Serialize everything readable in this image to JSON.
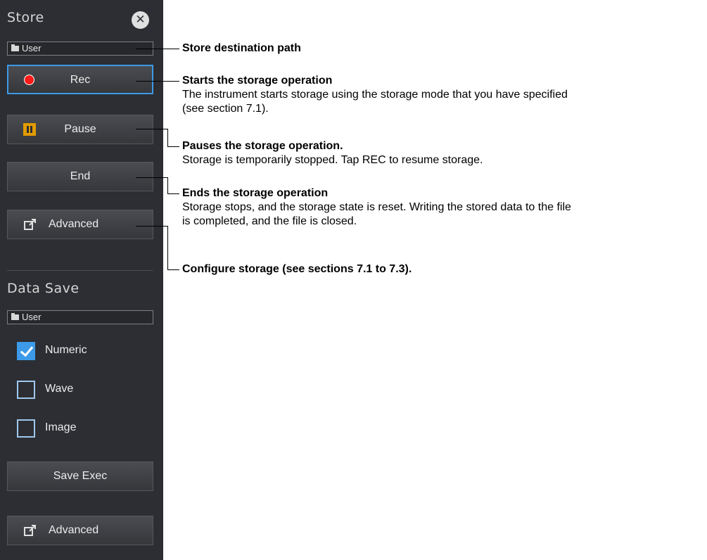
{
  "store": {
    "title": "Store",
    "close_glyph": "✕",
    "path_label": "User",
    "rec_label": "Rec",
    "pause_label": "Pause",
    "end_label": "End",
    "advanced_label": "Advanced"
  },
  "data_save": {
    "title": "Data Save",
    "path_label": "User",
    "checkboxes": [
      {
        "label": "Numeric",
        "checked": true
      },
      {
        "label": "Wave",
        "checked": false
      },
      {
        "label": "Image",
        "checked": false
      }
    ],
    "save_exec_label": "Save Exec",
    "advanced_label": "Advanced"
  },
  "annotations": {
    "path": {
      "title": "Store destination path"
    },
    "rec": {
      "title": "Starts the storage operation",
      "line1": "The instrument starts storage using the storage mode that you have specified",
      "line2": "(see section 7.1)."
    },
    "pause": {
      "title": "Pauses the storage operation.",
      "line1": "Storage is temporarily stopped. Tap REC to resume storage."
    },
    "end": {
      "title": "Ends the storage operation",
      "line1": "Storage stops, and the storage state is reset. Writing the stored data to the file",
      "line2": "is completed, and the file is closed."
    },
    "advanced": {
      "title": "Configure storage (see sections 7.1 to 7.3)."
    }
  },
  "colors": {
    "panel_bg": "#2c2e33",
    "accent_blue": "#3c9ae8",
    "rec_red": "#ff1a1a",
    "pause_orange": "#e39b00"
  },
  "icons": [
    "close-icon",
    "folder-icon",
    "record-icon",
    "pause-icon",
    "external-window-icon",
    "checkmark-icon"
  ]
}
